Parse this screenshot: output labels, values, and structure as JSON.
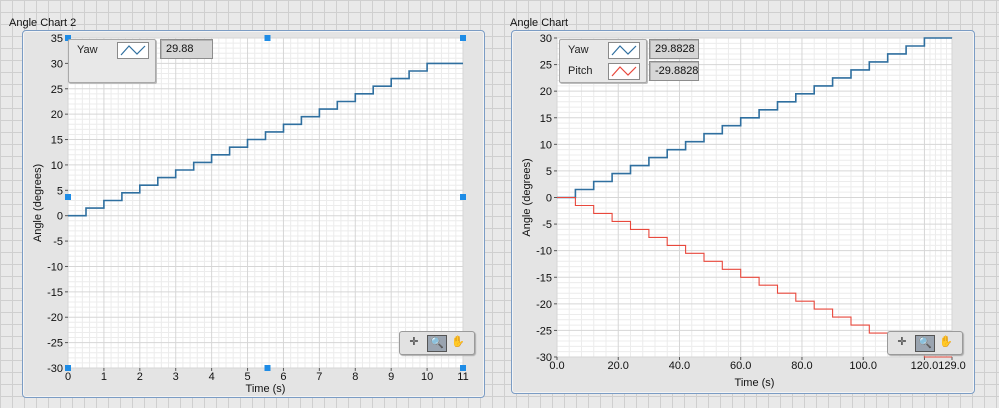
{
  "charts": [
    {
      "title": "Angle Chart 2",
      "readouts": [
        "29.88"
      ],
      "palette_icons": [
        "crosshair-icon",
        "zoom-icon",
        "pan-hand-icon"
      ]
    },
    {
      "title": "Angle Chart",
      "readouts": [
        "29.8828",
        "-29.8828"
      ],
      "palette_icons": [
        "crosshair-icon",
        "zoom-icon",
        "pan-hand-icon"
      ]
    }
  ],
  "colors": {
    "yaw": "#2f6f9f",
    "pitch": "#e8483c",
    "plot_bg": "#ffffff",
    "grid": "#d6d6d6"
  },
  "chart_data": [
    {
      "type": "line",
      "title": "Angle Chart 2",
      "xlabel": "Time (s)",
      "ylabel": "Angle (degrees)",
      "xlim": [
        0,
        11
      ],
      "ylim": [
        -30,
        35
      ],
      "xticks": [
        0,
        1,
        2,
        3,
        4,
        5,
        6,
        7,
        8,
        9,
        10,
        11
      ],
      "xtick_labels": [
        "0",
        "1",
        "2",
        "3",
        "4",
        "5",
        "6",
        "7",
        "8",
        "9",
        "10",
        "11"
      ],
      "yticks": [
        35,
        30,
        25,
        20,
        15,
        10,
        5,
        0,
        -5,
        -10,
        -15,
        -20,
        -25,
        -30
      ],
      "ytick_labels": [
        "35",
        "30",
        "25",
        "20",
        "15",
        "10",
        "5",
        "0",
        "-5",
        "-10",
        "-15",
        "-20",
        "-25",
        "-30"
      ],
      "grid": true,
      "legend_position": "top-left",
      "series": [
        {
          "name": "Yaw",
          "x": [
            0,
            0.5,
            0.5,
            1.0,
            1.0,
            1.5,
            1.5,
            2.0,
            2.0,
            2.5,
            2.5,
            3.0,
            3.0,
            3.5,
            3.5,
            4.0,
            4.0,
            4.5,
            4.5,
            5.0,
            5.0,
            5.5,
            5.5,
            6.0,
            6.0,
            6.5,
            6.5,
            7.0,
            7.0,
            7.5,
            7.5,
            8.0,
            8.0,
            8.5,
            8.5,
            9.0,
            9.0,
            9.5,
            9.5,
            10.0,
            10.0,
            10.5,
            10.5,
            11
          ],
          "y": [
            0,
            0,
            1.5,
            1.5,
            3.0,
            3.0,
            4.5,
            4.5,
            6.0,
            6.0,
            7.5,
            7.5,
            9.0,
            9.0,
            10.5,
            10.5,
            12.0,
            12.0,
            13.5,
            13.5,
            15.0,
            15.0,
            16.5,
            16.5,
            18.0,
            18.0,
            19.5,
            19.5,
            21.0,
            21.0,
            22.5,
            22.5,
            24.0,
            24.0,
            25.5,
            25.5,
            27.0,
            27.0,
            28.5,
            28.5,
            30.0,
            30.0,
            30.0,
            30.0
          ]
        }
      ]
    },
    {
      "type": "line",
      "title": "Angle Chart",
      "xlabel": "Time (s)",
      "ylabel": "Angle (degrees)",
      "xlim": [
        0,
        129
      ],
      "ylim": [
        -30,
        30
      ],
      "xticks": [
        0,
        20,
        40,
        60,
        80,
        100,
        120,
        129
      ],
      "xtick_labels": [
        "0.0",
        "20.0",
        "40.0",
        "60.0",
        "80.0",
        "100.0",
        "120.0",
        "129.0"
      ],
      "yticks": [
        30,
        25,
        20,
        15,
        10,
        5,
        0,
        -5,
        -10,
        -15,
        -20,
        -25,
        -30
      ],
      "ytick_labels": [
        "30",
        "25",
        "20",
        "15",
        "10",
        "5",
        "0",
        "-5",
        "-10",
        "-15",
        "-20",
        "-25",
        "-30"
      ],
      "grid": true,
      "legend_position": "top-left",
      "series": [
        {
          "name": "Yaw",
          "x": [
            0,
            6,
            6,
            12,
            12,
            18,
            18,
            24,
            24,
            30,
            30,
            36,
            36,
            42,
            42,
            48,
            48,
            54,
            54,
            60,
            60,
            66,
            66,
            72,
            72,
            78,
            78,
            84,
            84,
            90,
            90,
            96,
            96,
            102,
            102,
            108,
            108,
            114,
            114,
            120,
            120,
            129
          ],
          "y": [
            0,
            0,
            1.5,
            1.5,
            3.0,
            3.0,
            4.5,
            4.5,
            6.0,
            6.0,
            7.5,
            7.5,
            9.0,
            9.0,
            10.5,
            10.5,
            12.0,
            12.0,
            13.5,
            13.5,
            15.0,
            15.0,
            16.5,
            16.5,
            18.0,
            18.0,
            19.5,
            19.5,
            21.0,
            21.0,
            22.5,
            22.5,
            24.0,
            24.0,
            25.5,
            25.5,
            27.0,
            27.0,
            28.5,
            28.5,
            30.0,
            30.0
          ]
        },
        {
          "name": "Pitch",
          "x": [
            0,
            6,
            6,
            12,
            12,
            18,
            18,
            24,
            24,
            30,
            30,
            36,
            36,
            42,
            42,
            48,
            48,
            54,
            54,
            60,
            60,
            66,
            66,
            72,
            72,
            78,
            78,
            84,
            84,
            90,
            90,
            96,
            96,
            102,
            102,
            108,
            108,
            114,
            114,
            120,
            120,
            129
          ],
          "y": [
            0,
            0,
            -1.5,
            -1.5,
            -3.0,
            -3.0,
            -4.5,
            -4.5,
            -6.0,
            -6.0,
            -7.5,
            -7.5,
            -9.0,
            -9.0,
            -10.5,
            -10.5,
            -12.0,
            -12.0,
            -13.5,
            -13.5,
            -15.0,
            -15.0,
            -16.5,
            -16.5,
            -18.0,
            -18.0,
            -19.5,
            -19.5,
            -21.0,
            -21.0,
            -22.5,
            -22.5,
            -24.0,
            -24.0,
            -25.5,
            -25.5,
            -27.0,
            -27.0,
            -28.5,
            -28.5,
            -30.0,
            -30.0
          ]
        }
      ]
    }
  ]
}
